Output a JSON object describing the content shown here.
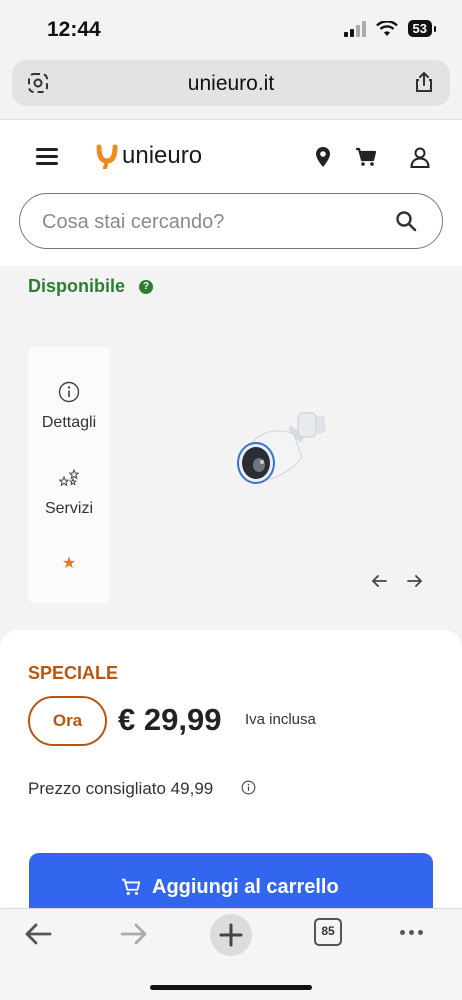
{
  "status_bar": {
    "time": "12:44",
    "battery": "53"
  },
  "browser": {
    "url": "unieuro.it"
  },
  "header": {
    "logo_text": "unieuro"
  },
  "search": {
    "placeholder": "Cosa stai cercando?"
  },
  "availability": {
    "label": "Disponibile"
  },
  "side_menu": {
    "details": "Dettagli",
    "services": "Servizi"
  },
  "pricing": {
    "badge": "SPECIALE",
    "now_label": "Ora",
    "price": "€ 29,99",
    "tax_note": "Iva inclusa",
    "recommended": "Prezzo consigliato 49,99"
  },
  "cart_button": {
    "label": "Aggiungi al carrello"
  },
  "bottom_bar": {
    "tab_count": "85"
  },
  "colors": {
    "accent_blue": "#3366ee",
    "speciale": "#b8560f",
    "available": "#2f7d32",
    "logo_orange": "#f08a1c"
  }
}
